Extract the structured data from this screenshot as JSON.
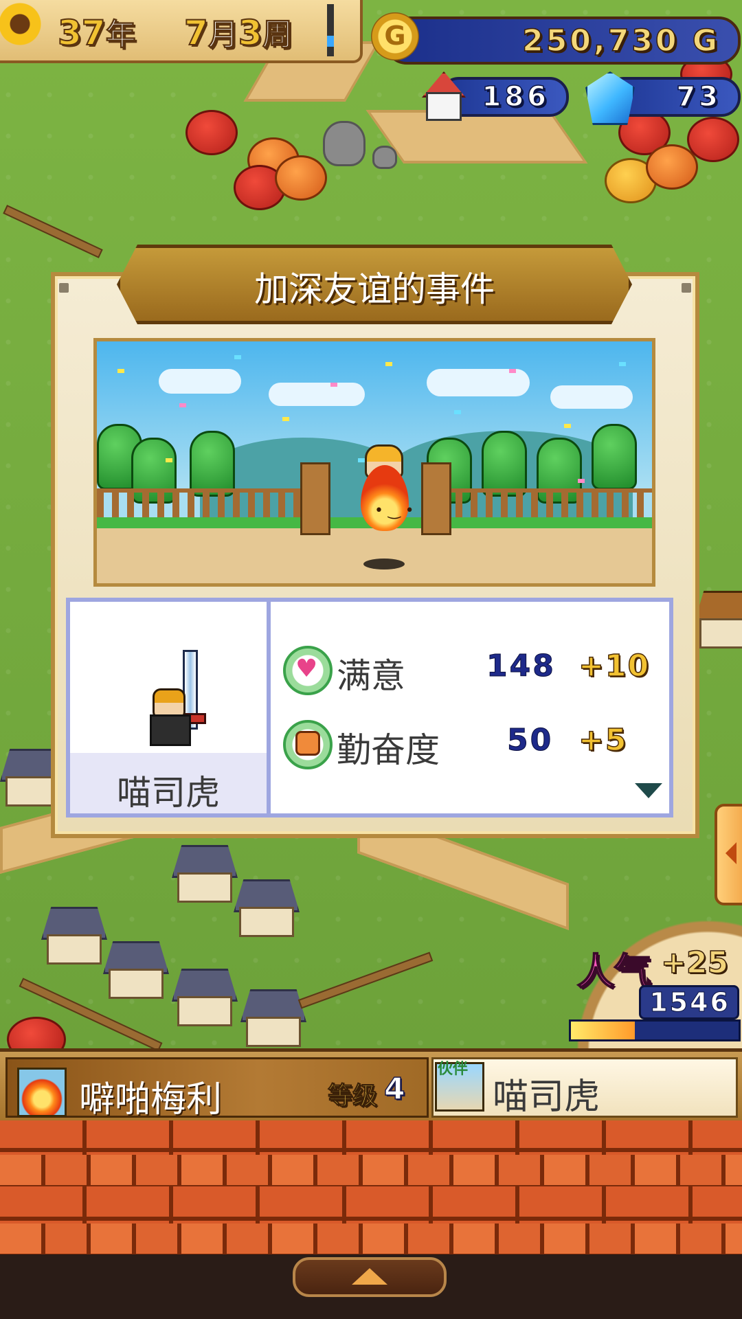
{
  "hud": {
    "year_num": "37",
    "year_unit": "年",
    "month_num": "7",
    "month_unit": "月",
    "week_num": "3",
    "week_unit": "周",
    "coin_symbol": "G",
    "gold": "250,730 G",
    "houses": "186",
    "crystals": "73"
  },
  "dialog": {
    "title": "加深友谊的事件",
    "character_name": "喵司虎",
    "stats": [
      {
        "label": "满意",
        "value": "148",
        "delta": "+10",
        "icon": "heart-icon"
      },
      {
        "label": "勤奋度",
        "value": "50",
        "delta": "+5",
        "icon": "fist-icon"
      }
    ]
  },
  "popularity": {
    "label": "人气",
    "delta": "+25",
    "value": "1546",
    "progress_fraction": 0.38
  },
  "status_bar": {
    "name": "噼啪梅利",
    "level_label": "等级",
    "level": "4",
    "partner_tag": "伙伴",
    "partner_name": "喵司虎"
  },
  "colors": {
    "gold_text": "#f3d77a",
    "stat_value": "#1e2a8a",
    "stat_delta": "#f2c232",
    "popularity_label": "#ff5ac0"
  }
}
